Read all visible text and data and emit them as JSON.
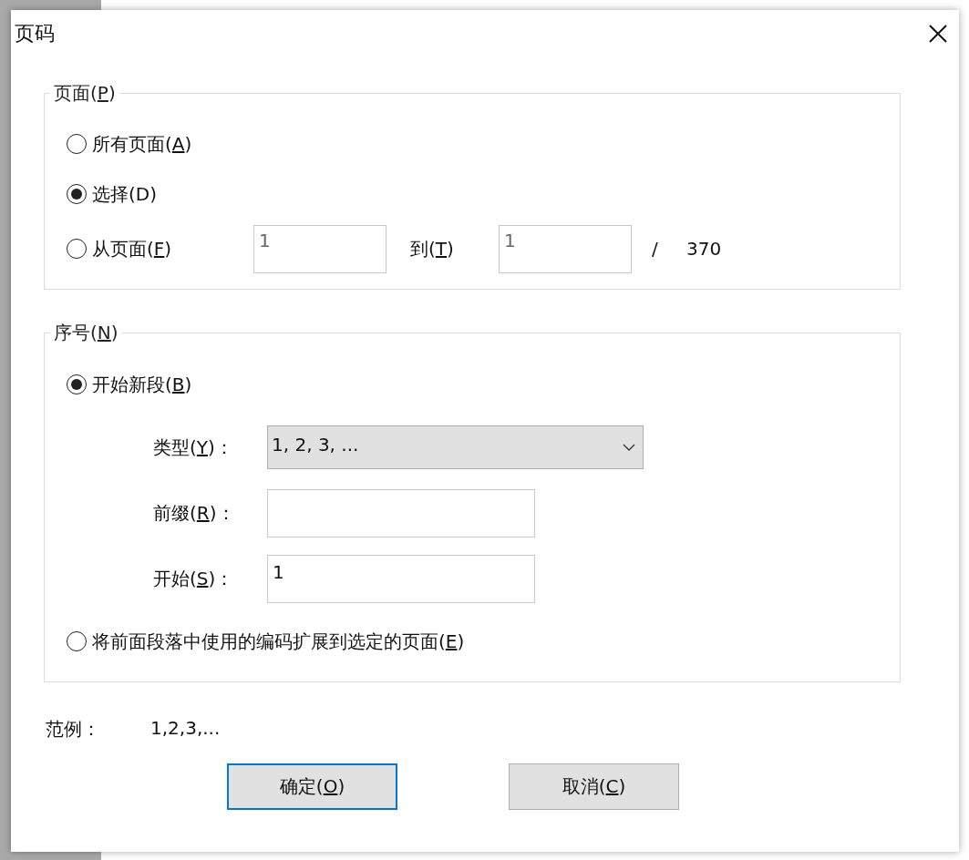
{
  "window": {
    "title": "页码"
  },
  "pages_group": {
    "legend": {
      "text": "页面(",
      "key": "P",
      "after": ")"
    },
    "options": [
      {
        "kind": "plain",
        "label": {
          "text": "所有页面(",
          "key": "A",
          "after": ")"
        },
        "selected": false
      },
      {
        "kind": "plain",
        "label": {
          "text": "选择(D)"
        },
        "selected": true
      },
      {
        "kind": "range",
        "label": {
          "text": "从页面(",
          "key": "F",
          "after": ")"
        },
        "selected": false,
        "from": "1",
        "to_label": {
          "text": "到(",
          "key": "T",
          "after": ")"
        },
        "to": "1",
        "separator": "/",
        "total": "370"
      }
    ]
  },
  "numbering_group": {
    "legend": {
      "text": "序号(",
      "key": "N",
      "after": ")"
    },
    "options": [
      {
        "kind": "new_section",
        "label": {
          "text": "开始新段(",
          "key": "B",
          "after": ")"
        },
        "selected": true,
        "fields": [
          {
            "kind": "dropdown",
            "label": {
              "text": "类型(",
              "key": "Y",
              "after": ")："
            },
            "value": "1, 2, 3, ..."
          },
          {
            "kind": "text",
            "label": {
              "text": "前缀(",
              "key": "R",
              "after": ")："
            }
          },
          {
            "kind": "text",
            "label": {
              "text": "开始(",
              "key": "S",
              "after": ")："
            },
            "value": "1"
          }
        ]
      },
      {
        "kind": "plain",
        "label": {
          "text": "将前面段落中使用的编码扩展到选定的页面(",
          "key": "E",
          "after": ")"
        },
        "selected": false
      }
    ]
  },
  "example": {
    "label": "范例：",
    "value": "1,2,3,..."
  },
  "buttons": [
    {
      "label": {
        "text": "确定(",
        "key": "O",
        "after": ")"
      },
      "default": true
    },
    {
      "label": {
        "text": "取消(",
        "key": "C",
        "after": ")"
      },
      "default": false
    }
  ]
}
